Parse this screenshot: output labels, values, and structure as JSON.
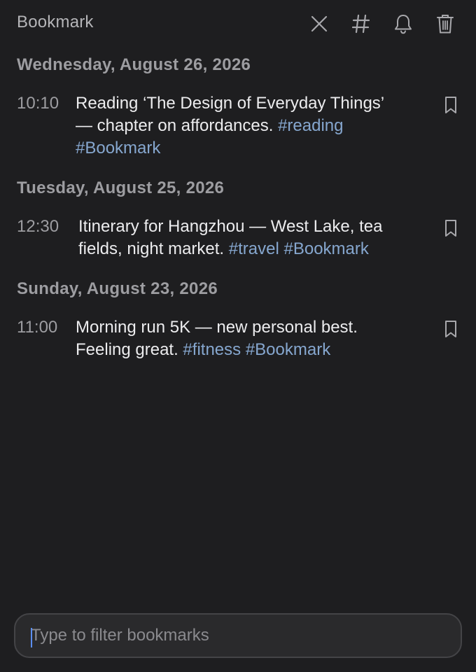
{
  "header": {
    "title": "Bookmark",
    "icons": [
      "close-icon",
      "hashtag-icon",
      "bell-icon",
      "trash-icon"
    ]
  },
  "groups": [
    {
      "date": "Wednesday, August 26, 2026",
      "entries": [
        {
          "time": "10:10",
          "text_lines": [
            [
              {
                "t": "Reading ‘The Design of Everyday Things’",
                "tag": false
              }
            ],
            [
              {
                "t": "— chapter on affordances. ",
                "tag": false
              },
              {
                "t": "#reading",
                "tag": true
              }
            ],
            [
              {
                "t": "#Bookmark",
                "tag": true
              }
            ]
          ],
          "icon": "bookmark-icon"
        }
      ]
    },
    {
      "date": "Tuesday, August 25, 2026",
      "entries": [
        {
          "time": "12:30",
          "text_lines": [
            [
              {
                "t": "Itinerary for Hangzhou — West Lake, tea",
                "tag": false
              }
            ],
            [
              {
                "t": "fields, night market. ",
                "tag": false
              },
              {
                "t": "#travel",
                "tag": true
              },
              {
                "t": " ",
                "tag": false
              },
              {
                "t": "#Bookmark",
                "tag": true
              }
            ]
          ],
          "icon": "bookmark-icon"
        }
      ]
    },
    {
      "date": "Sunday, August 23, 2026",
      "entries": [
        {
          "time": "11:00",
          "text_lines": [
            [
              {
                "t": "Morning run 5K — new personal best.",
                "tag": false
              }
            ],
            [
              {
                "t": "Feeling great. ",
                "tag": false
              },
              {
                "t": "#fitness",
                "tag": true
              },
              {
                "t": " ",
                "tag": false
              },
              {
                "t": "#Bookmark",
                "tag": true
              }
            ]
          ],
          "icon": "bookmark-icon"
        }
      ]
    }
  ],
  "filter": {
    "placeholder": "Type to filter bookmarks",
    "value": ""
  },
  "colors": {
    "background": "#1e1e20",
    "tag": "#86a7cf",
    "muted": "#9d9da1",
    "text": "#ececee",
    "caret": "#5b8ef0"
  }
}
